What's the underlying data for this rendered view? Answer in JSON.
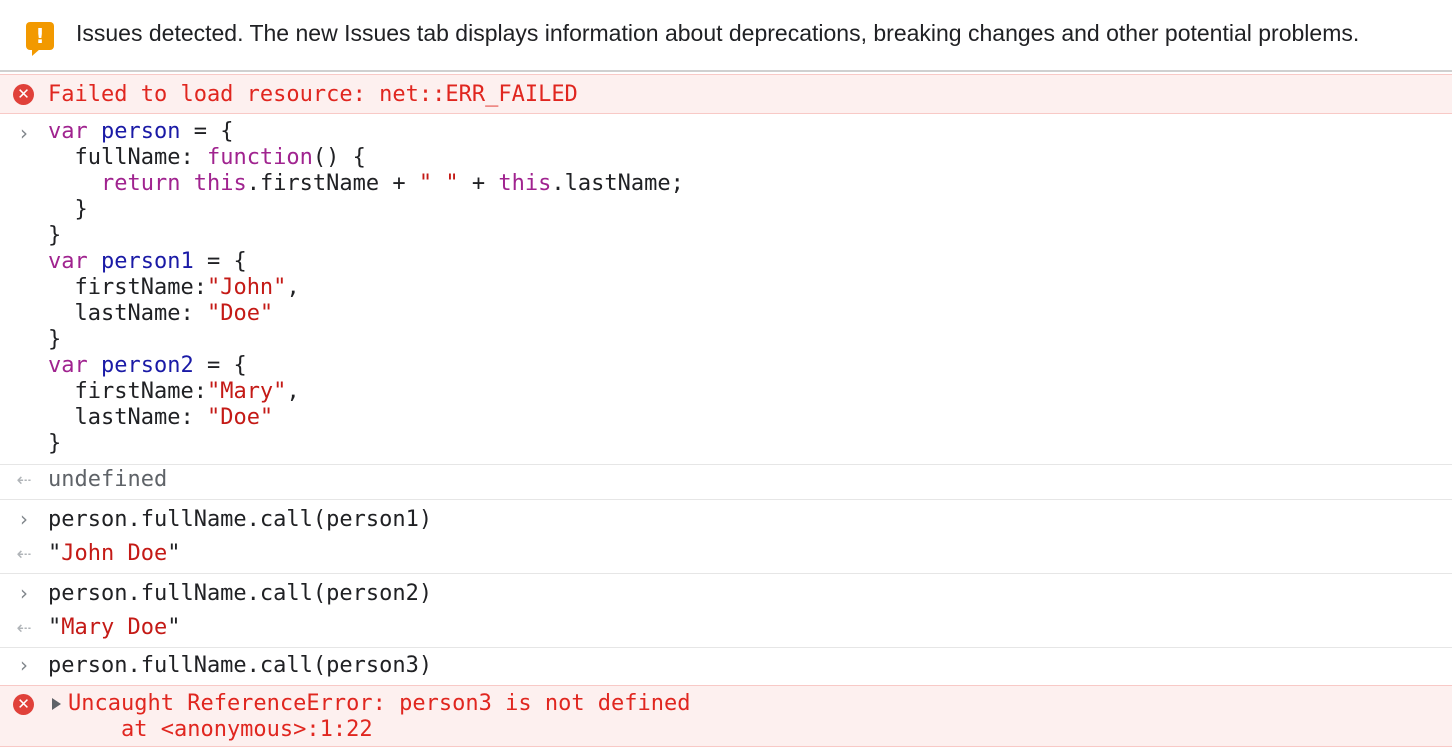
{
  "banner": {
    "icon": "warning-icon",
    "text": "Issues detected. The new Issues tab displays information about deprecations, breaking changes and other potential problems."
  },
  "console": {
    "load_error": {
      "icon": "error-icon",
      "text": "Failed to load resource: net::ERR_FAILED"
    },
    "input_block": {
      "prompt_icon": "chevron-right-icon",
      "lines": [
        [
          {
            "t": "var",
            "c": "kw"
          },
          {
            "t": " ",
            "c": "plain"
          },
          {
            "t": "person",
            "c": "var"
          },
          {
            "t": " = {",
            "c": "plain"
          }
        ],
        [
          {
            "t": "  fullName: ",
            "c": "plain"
          },
          {
            "t": "function",
            "c": "kw"
          },
          {
            "t": "() {",
            "c": "plain"
          }
        ],
        [
          {
            "t": "    ",
            "c": "plain"
          },
          {
            "t": "return",
            "c": "kw"
          },
          {
            "t": " ",
            "c": "plain"
          },
          {
            "t": "this",
            "c": "kw"
          },
          {
            "t": ".firstName + ",
            "c": "plain"
          },
          {
            "t": "\" \"",
            "c": "str"
          },
          {
            "t": " + ",
            "c": "plain"
          },
          {
            "t": "this",
            "c": "kw"
          },
          {
            "t": ".lastName;",
            "c": "plain"
          }
        ],
        [
          {
            "t": "  }",
            "c": "plain"
          }
        ],
        [
          {
            "t": "}",
            "c": "plain"
          }
        ],
        [
          {
            "t": "var",
            "c": "kw"
          },
          {
            "t": " ",
            "c": "plain"
          },
          {
            "t": "person1",
            "c": "var"
          },
          {
            "t": " = {",
            "c": "plain"
          }
        ],
        [
          {
            "t": "  firstName:",
            "c": "plain"
          },
          {
            "t": "\"John\"",
            "c": "str"
          },
          {
            "t": ",",
            "c": "plain"
          }
        ],
        [
          {
            "t": "  lastName: ",
            "c": "plain"
          },
          {
            "t": "\"Doe\"",
            "c": "str"
          }
        ],
        [
          {
            "t": "}",
            "c": "plain"
          }
        ],
        [
          {
            "t": "var",
            "c": "kw"
          },
          {
            "t": " ",
            "c": "plain"
          },
          {
            "t": "person2",
            "c": "var"
          },
          {
            "t": " = {",
            "c": "plain"
          }
        ],
        [
          {
            "t": "  firstName:",
            "c": "plain"
          },
          {
            "t": "\"Mary\"",
            "c": "str"
          },
          {
            "t": ",",
            "c": "plain"
          }
        ],
        [
          {
            "t": "  lastName: ",
            "c": "plain"
          },
          {
            "t": "\"Doe\"",
            "c": "str"
          }
        ],
        [
          {
            "t": "}",
            "c": "plain"
          }
        ]
      ]
    },
    "result_undefined": {
      "icon": "return-arrow-icon",
      "text": "undefined"
    },
    "call1": {
      "input": "person.fullName.call(person1)",
      "result_quote_open": "\"",
      "result_value": "John Doe",
      "result_quote_close": "\""
    },
    "call2": {
      "input": "person.fullName.call(person2)",
      "result_quote_open": "\"",
      "result_value": "Mary Doe",
      "result_quote_close": "\""
    },
    "call3": {
      "input": "person.fullName.call(person3)"
    },
    "uncaught_error": {
      "icon": "error-icon",
      "expand_icon": "triangle-right-icon",
      "message": "Uncaught ReferenceError: person3 is not defined",
      "stack": "    at <anonymous>:1:22"
    }
  },
  "colors": {
    "keyword": "#a0238f",
    "variable": "#1a1aa6",
    "string": "#c41a16",
    "error": "#e0261f",
    "error_bg": "#fdf0ef",
    "warning": "#f29900"
  }
}
